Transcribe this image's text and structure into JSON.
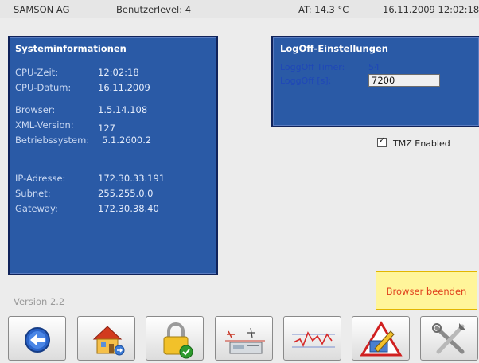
{
  "topbar": {
    "company": "SAMSON AG",
    "userlevel": "Benutzerlevel:  4",
    "temperature": "AT: 14.3 °C",
    "datetime": "16.11.2009  12:02:18"
  },
  "sysinfo": {
    "title": "Systeminformationen",
    "rows": [
      {
        "label": "CPU-Zeit:",
        "value": "12:02:18"
      },
      {
        "label": "CPU-Datum:",
        "value": "16.11.2009"
      },
      {
        "label": "Browser:",
        "value": "1.5.14.108"
      },
      {
        "label": "XML-Version:",
        "value": "127"
      },
      {
        "label": "Betriebssystem:",
        "value": "5.1.2600.2"
      },
      {
        "label": "IP-Adresse:",
        "value": "172.30.33.191"
      },
      {
        "label": "Subnet:",
        "value": "255.255.0.0"
      },
      {
        "label": "Gateway:",
        "value": "172.30.38.40"
      }
    ]
  },
  "logoff": {
    "title": "LogOff-Einstellungen",
    "timer_label": "LoggOff Timer:",
    "timer_value": "54",
    "seconds_label": "LoggOff [s]:",
    "seconds_value": "7200"
  },
  "tmz": {
    "label": "TMZ Enabled",
    "checked": true,
    "checkmark": "✓"
  },
  "version": "Version 2.2",
  "exit_button": "Browser beenden",
  "nav_icons": [
    "back-arrow-icon",
    "home-icon",
    "lock-icon",
    "device-icon",
    "trend-chart-icon",
    "warning-edit-icon",
    "tools-icon"
  ]
}
